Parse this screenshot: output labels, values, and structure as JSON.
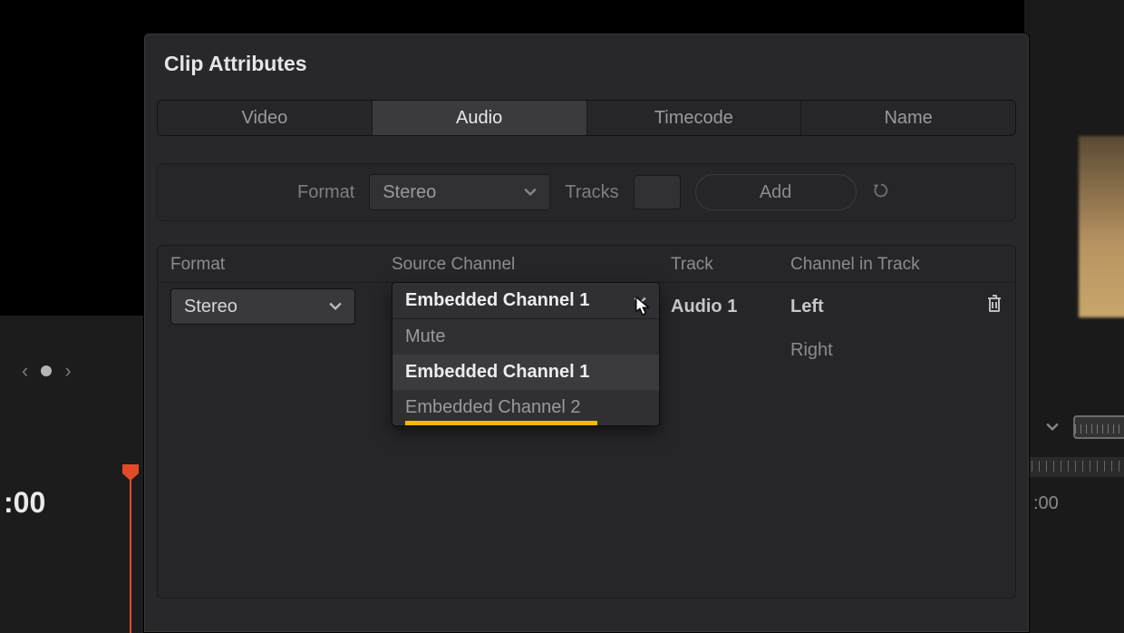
{
  "dialog": {
    "title": "Clip Attributes",
    "tabs": [
      {
        "label": "Video"
      },
      {
        "label": "Audio",
        "active": true
      },
      {
        "label": "Timecode"
      },
      {
        "label": "Name"
      }
    ],
    "controls": {
      "format_label": "Format",
      "format_value": "Stereo",
      "tracks_label": "Tracks",
      "tracks_value": "",
      "add_label": "Add"
    },
    "columns": {
      "format": "Format",
      "source_channel": "Source Channel",
      "track": "Track",
      "channel_in_track": "Channel in Track"
    },
    "rows": [
      {
        "format_value": "Stereo",
        "source_channel_value": "Embedded Channel 1",
        "track": "Audio 1",
        "channel_in_track": "Left"
      },
      {
        "channel_in_track": "Right"
      }
    ],
    "source_channel_dropdown": {
      "selected": "Embedded Channel 1",
      "options": [
        {
          "label": "Mute"
        },
        {
          "label": "Embedded Channel 1",
          "highlight": true
        },
        {
          "label": "Embedded Channel 2",
          "underline": true
        }
      ]
    }
  },
  "backdrop": {
    "timecode_left": ":00",
    "timecode_right": ":00"
  }
}
